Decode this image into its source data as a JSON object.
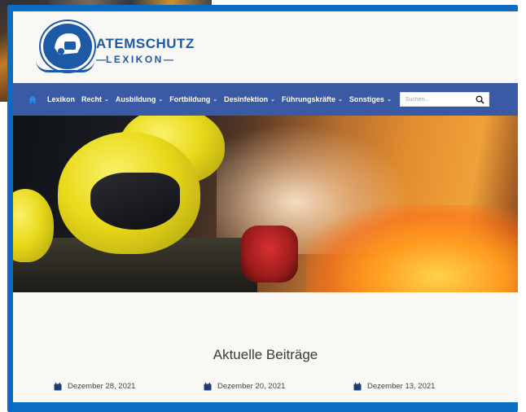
{
  "site": {
    "logo_title": "ATEMSCHUTZ",
    "logo_subtitle": "LEXIKON"
  },
  "nav": {
    "items": [
      {
        "label": "Lexikon",
        "dropdown": false
      },
      {
        "label": "Recht",
        "dropdown": true
      },
      {
        "label": "Ausbildung",
        "dropdown": true
      },
      {
        "label": "Fortbildung",
        "dropdown": true
      },
      {
        "label": "Desinfektion",
        "dropdown": true
      },
      {
        "label": "Führungskräfte",
        "dropdown": true
      },
      {
        "label": "Sonstiges",
        "dropdown": true
      }
    ],
    "search_placeholder": "Suchen..."
  },
  "content": {
    "section_title": "Aktuelle Beiträge",
    "posts": [
      {
        "date": "Dezember 28, 2021"
      },
      {
        "date": "Dezember 20, 2021"
      },
      {
        "date": "Dezember 13, 2021"
      }
    ]
  },
  "colors": {
    "frame": "#0a6dc3",
    "nav_bg": "#3a5aa6",
    "brand": "#1c5aa8",
    "page_bg": "#faf8f4"
  },
  "icons": {
    "home": "home-icon",
    "search": "search-icon",
    "calendar": "calendar-icon",
    "chevron": "chevron-down-icon"
  }
}
